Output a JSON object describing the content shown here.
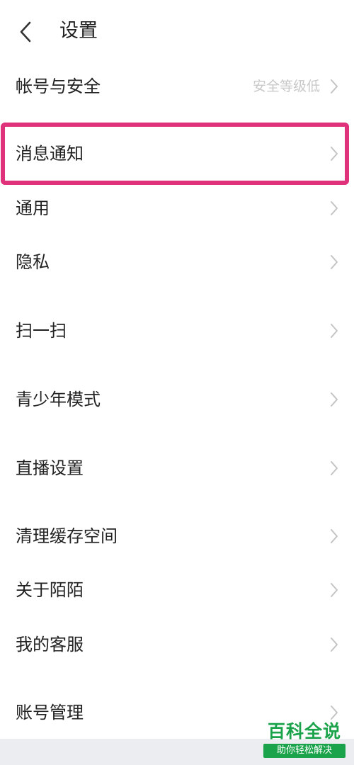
{
  "header": {
    "title": "设置",
    "back_icon": "chevron-left-icon"
  },
  "settings": {
    "items": [
      {
        "label": "帐号与安全",
        "value": "安全等级低"
      },
      {
        "label": "消息通知",
        "value": ""
      },
      {
        "label": "通用",
        "value": ""
      },
      {
        "label": "隐私",
        "value": ""
      },
      {
        "label": "扫一扫",
        "value": ""
      },
      {
        "label": "青少年模式",
        "value": ""
      },
      {
        "label": "直播设置",
        "value": ""
      },
      {
        "label": "清理缓存空间",
        "value": ""
      },
      {
        "label": "关于陌陌",
        "value": ""
      },
      {
        "label": "我的客服",
        "value": ""
      },
      {
        "label": "账号管理",
        "value": ""
      }
    ],
    "chevron_icon": "chevron-right-icon"
  },
  "highlight": {
    "color": "#e0327a",
    "target": "消息通知"
  },
  "watermark": {
    "title": "百科全说",
    "subtitle": "助你轻松解决",
    "color": "#1aa34a"
  }
}
